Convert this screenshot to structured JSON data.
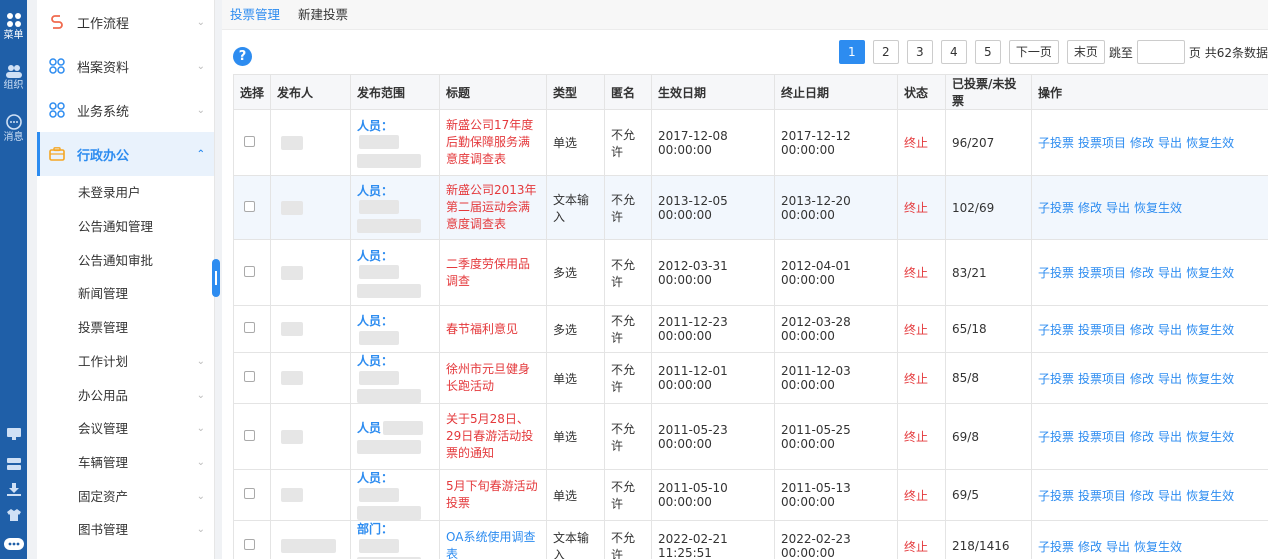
{
  "rail": {
    "items": [
      {
        "label": "菜单",
        "icon": "apps-icon"
      },
      {
        "label": "组织",
        "icon": "users-icon"
      },
      {
        "label": "消息",
        "icon": "message-icon"
      }
    ]
  },
  "sidebar": {
    "top_menus": [
      {
        "label": "工作流程",
        "icon": "workflow-icon"
      },
      {
        "label": "档案资料",
        "icon": "archive-icon"
      },
      {
        "label": "业务系统",
        "icon": "business-icon"
      },
      {
        "label": "行政办公",
        "icon": "briefcase-icon"
      }
    ],
    "sub_items": [
      {
        "label": "未登录用户",
        "chevron": false
      },
      {
        "label": "公告通知管理",
        "chevron": false
      },
      {
        "label": "公告通知审批",
        "chevron": false
      },
      {
        "label": "新闻管理",
        "chevron": false
      },
      {
        "label": "投票管理",
        "chevron": false
      },
      {
        "label": "工作计划",
        "chevron": true
      },
      {
        "label": "办公用品",
        "chevron": true
      },
      {
        "label": "会议管理",
        "chevron": true
      },
      {
        "label": "车辆管理",
        "chevron": true
      },
      {
        "label": "固定资产",
        "chevron": true
      },
      {
        "label": "图书管理",
        "chevron": true
      }
    ]
  },
  "breadcrumb": {
    "active": "投票管理",
    "next": "新建投票"
  },
  "pager": {
    "pages": [
      "1",
      "2",
      "3",
      "4",
      "5"
    ],
    "current": "1",
    "next_label": "下一页",
    "last_label": "末页",
    "jump_label": "跳至",
    "suffix": "页 共62条数据"
  },
  "table": {
    "headers": [
      "选择",
      "发布人",
      "发布范围",
      "标题",
      "类型",
      "匿名",
      "生效日期",
      "终止日期",
      "状态",
      "已投票/未投票",
      "操作"
    ],
    "rows": [
      {
        "scope_label": "人员：",
        "title": "新盛公司17年度后勤保障服务满意度调查表",
        "title_color": "red",
        "type": "单选",
        "anonymous": "不允许",
        "start": "2017-12-08 00:00:00",
        "end": "2017-12-12 00:00:00",
        "status": "终止",
        "votes": "96/207",
        "actions": [
          "子投票",
          "投票项目",
          "修改",
          "导出",
          "恢复生效"
        ]
      },
      {
        "scope_label": "人员：",
        "title": "新盛公司2013年第二届运动会满意度调查表",
        "title_color": "red",
        "type": "文本输入",
        "anonymous": "不允许",
        "start": "2013-12-05 00:00:00",
        "end": "2013-12-20 00:00:00",
        "status": "终止",
        "votes": "102/69",
        "actions": [
          "子投票",
          "修改",
          "导出",
          "恢复生效"
        ]
      },
      {
        "scope_label": "人员：",
        "title": "二季度劳保用品调查",
        "title_color": "red",
        "type": "多选",
        "anonymous": "不允许",
        "start": "2012-03-31 00:00:00",
        "end": "2012-04-01 00:00:00",
        "status": "终止",
        "votes": "83/21",
        "actions": [
          "子投票",
          "投票项目",
          "修改",
          "导出",
          "恢复生效"
        ]
      },
      {
        "scope_label": "人员：",
        "title": "春节福利意见",
        "title_color": "red",
        "type": "多选",
        "anonymous": "不允许",
        "start": "2011-12-23 00:00:00",
        "end": "2012-03-28 00:00:00",
        "status": "终止",
        "votes": "65/18",
        "actions": [
          "子投票",
          "投票项目",
          "修改",
          "导出",
          "恢复生效"
        ]
      },
      {
        "scope_label": "人员：",
        "title": "徐州市元旦健身长跑活动",
        "title_color": "red",
        "type": "单选",
        "anonymous": "不允许",
        "start": "2011-12-01 00:00:00",
        "end": "2011-12-03 00:00:00",
        "status": "终止",
        "votes": "85/8",
        "actions": [
          "子投票",
          "投票项目",
          "修改",
          "导出",
          "恢复生效"
        ]
      },
      {
        "scope_label": "人员",
        "title": "关于5月28日、29日春游活动投票的通知",
        "title_color": "red",
        "type": "单选",
        "anonymous": "不允许",
        "start": "2011-05-23 00:00:00",
        "end": "2011-05-25 00:00:00",
        "status": "终止",
        "votes": "69/8",
        "actions": [
          "子投票",
          "投票项目",
          "修改",
          "导出",
          "恢复生效"
        ]
      },
      {
        "scope_label": "人员：",
        "title": "5月下旬春游活动投票",
        "title_color": "red",
        "type": "单选",
        "anonymous": "不允许",
        "start": "2011-05-10 00:00:00",
        "end": "2011-05-13 00:00:00",
        "status": "终止",
        "votes": "69/5",
        "actions": [
          "子投票",
          "投票项目",
          "修改",
          "导出",
          "恢复生效"
        ]
      },
      {
        "scope_label": "部门：",
        "title": "OA系统使用调查表",
        "title_color": "blue",
        "type": "文本输入",
        "anonymous": "不允许",
        "start": "2022-02-21 11:25:51",
        "end": "2022-02-23 00:00:00",
        "status": "终止",
        "votes": "218/1416",
        "actions": [
          "子投票",
          "修改",
          "导出",
          "恢复生效"
        ]
      }
    ]
  },
  "colors": {
    "accent": "#2d8cf0",
    "rail": "#1f5fa8",
    "danger": "#e4393c"
  }
}
